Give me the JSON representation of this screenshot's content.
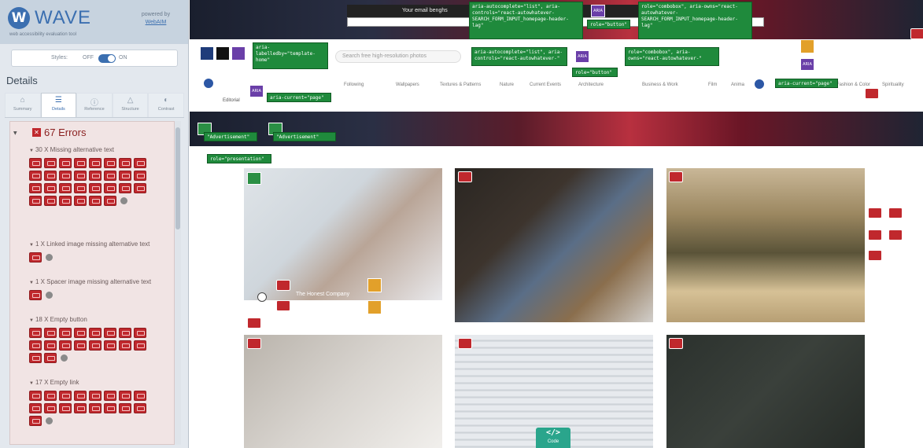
{
  "wave": {
    "title": "WAVE",
    "tagline": "web accessibility evaluation tool",
    "powered_by": "powered by",
    "powered_by_link": "WebAIM",
    "styles_label": "Styles:",
    "styles_off": "OFF",
    "styles_on": "ON",
    "details_heading": "Details",
    "tabs": [
      {
        "label": "Summary",
        "icon": "home-icon",
        "glyph": "⌂"
      },
      {
        "label": "Details",
        "icon": "list-icon",
        "glyph": "☰"
      },
      {
        "label": "Reference",
        "icon": "info-icon",
        "glyph": "ⓘ"
      },
      {
        "label": "Structure",
        "icon": "structure-icon",
        "glyph": "△"
      },
      {
        "label": "Contrast",
        "icon": "contrast-icon",
        "glyph": "◐"
      }
    ],
    "errors": {
      "count_label": "67 Errors",
      "groups": [
        {
          "title": "30 X Missing alternative text",
          "icon_count": 30
        },
        {
          "title": "1 X Linked image missing alternative text",
          "icon_count": 1
        },
        {
          "title": "1 X Spacer image missing alternative text",
          "icon_count": 1
        },
        {
          "title": "18 X Empty button",
          "icon_count": 18
        },
        {
          "title": "17 X Empty link",
          "icon_count": 17
        }
      ]
    }
  },
  "page": {
    "email_bar_text": "Your email benghs",
    "search_placeholder": "Search free high-resolution photos",
    "editorial_label": "Editorial",
    "nav_items": [
      "Following",
      "Wallpapers",
      "Textures & Patterns",
      "Nature",
      "Current Events",
      "Architecture",
      "Business & Work",
      "Film",
      "Anima",
      "Fashion & Color",
      "Spirituality"
    ],
    "baby_caption": "The Honest Company",
    "code_badge": "</>",
    "code_label": "Code",
    "tags": {
      "aria_labelledby": "aria-labelledby=\"template-home\"",
      "aria_current_1": "aria-current=\"page\"",
      "aria_autocomplete_1": "aria-autocomplete=\"list\", aria-controls=\"react-autowhatever-SEARCH_FORM_INPUT_homepage-header-lag\"",
      "aria_autocomplete_2": "aria-autocomplete=\"list\", aria-controls=\"react-autowhatever-\"",
      "role_button_1": "role=\"button\"",
      "role_combobox_1": "role=\"combobox\", aria-owns=\"react-autowhatever-SEARCH_FORM_INPUT_homepage-header-lag\"",
      "role_button_2": "role=\"button\"",
      "role_combobox_2": "role=\"combobox\", aria-owns=\"react-autowhatever-\"",
      "aria_current_2": "aria-current=\"page\"",
      "advertisement_1": "\"Advertisement\"",
      "advertisement_2": "\"Advertisement\"",
      "role_presentation": "role=\"presentation\""
    }
  },
  "colors": {
    "wave_blue": "#3b6fb0",
    "error_red": "#c0282d",
    "aria_green": "#1f8a3c",
    "structure_purple": "#6a3fa8",
    "alert_orange": "#e2a02a"
  }
}
